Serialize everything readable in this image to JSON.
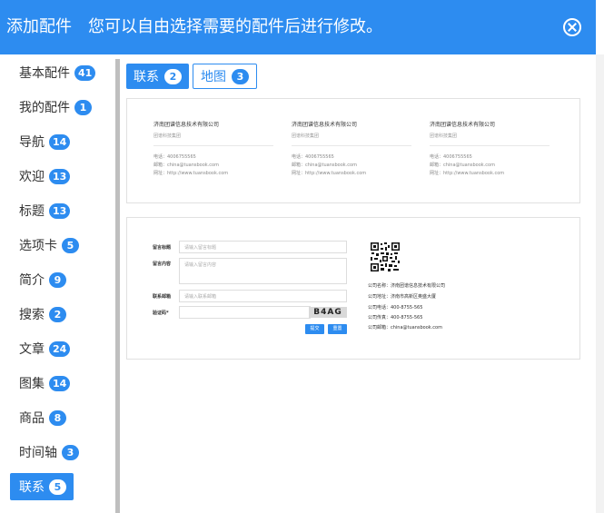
{
  "header": {
    "title": "添加配件",
    "subtitle": "您可以自由选择需要的配件后进行修改。"
  },
  "sidebar": {
    "items": [
      {
        "label": "基本配件",
        "count": "41"
      },
      {
        "label": "我的配件",
        "count": "1"
      },
      {
        "label": "导航",
        "count": "14"
      },
      {
        "label": "欢迎",
        "count": "13"
      },
      {
        "label": "标题",
        "count": "13"
      },
      {
        "label": "选项卡",
        "count": "5"
      },
      {
        "label": "简介",
        "count": "9"
      },
      {
        "label": "搜索",
        "count": "2"
      },
      {
        "label": "文章",
        "count": "24"
      },
      {
        "label": "图集",
        "count": "14"
      },
      {
        "label": "商品",
        "count": "8"
      },
      {
        "label": "时间轴",
        "count": "3"
      },
      {
        "label": "联系",
        "count": "5"
      }
    ]
  },
  "tabs": [
    {
      "label": "联系",
      "count": "2"
    },
    {
      "label": "地图",
      "count": "3"
    }
  ],
  "preview1": {
    "columns": [
      {
        "company": "济南团谱信息技术有限公司",
        "group": "团谱科技集团",
        "phone": "电话：4006755565",
        "email": "邮箱：china@tuansbook.com",
        "site": "网址：http://www.tuansbook.com"
      },
      {
        "company": "济南团谱信息技术有限公司",
        "group": "团谱科技集团",
        "phone": "电话：4006755565",
        "email": "邮箱：china@tuansbook.com",
        "site": "网址：http://www.tuansbook.com"
      },
      {
        "company": "济南团谱信息技术有限公司",
        "group": "团谱科技集团",
        "phone": "电话：4006755565",
        "email": "邮箱：china@tuansbook.com",
        "site": "网址：http://www.tuansbook.com"
      }
    ]
  },
  "preview2": {
    "form": {
      "title_label": "留言标题",
      "title_placeholder": "请输入留言标题",
      "content_label": "留言内容",
      "content_placeholder": "请输入留言内容",
      "email_label": "联系邮箱",
      "email_placeholder": "请输入联系邮箱",
      "code_label": "验证码*",
      "captcha": "B4AG",
      "submit": "提交",
      "reset": "重置"
    },
    "info": [
      "公司名称：济南团谱信息技术有限公司",
      "公司地址：济南市高新区奥盛大厦",
      "公司电话：400-8755-565",
      "公司传真：400-8755-565",
      "公司邮箱：china@tuansbook.com"
    ]
  }
}
